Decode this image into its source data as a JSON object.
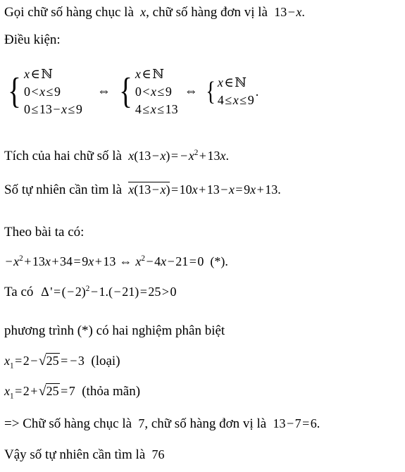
{
  "document": {
    "language": "vi",
    "background_color": "#ffffff",
    "text_color": "#000000"
  },
  "lines": {
    "l1": {
      "prose_a": "Gọi chữ số hàng chục là",
      "var_x": "x",
      "prose_b": ", chữ số hàng đơn vị là",
      "expr_13": "13",
      "minus": "−",
      "var_x2": "x",
      "period": "."
    },
    "l2": {
      "text": "Điều kiện:"
    },
    "systems": {
      "sys1": {
        "rows": [
          {
            "lhs": "x",
            "rel": "∈",
            "rhs": "ℕ"
          },
          {
            "a": "0",
            "rel1": "<",
            "v": "x",
            "rel2": "≤",
            "b": "9"
          },
          {
            "a": "0",
            "rel1": "≤",
            "mid_num": "13",
            "mid_op": "−",
            "mid_var": "x",
            "rel2": "≤",
            "b": "9"
          }
        ]
      },
      "equiv_1": "⇔",
      "sys2": {
        "rows": [
          {
            "lhs": "x",
            "rel": "∈",
            "rhs": "ℕ"
          },
          {
            "a": "0",
            "rel1": "<",
            "v": "x",
            "rel2": "≤",
            "b": "9"
          },
          {
            "a": "4",
            "rel1": "≤",
            "v": "x",
            "rel2": "≤",
            "b": "13"
          }
        ]
      },
      "equiv_2": "⇔",
      "sys3": {
        "rows": [
          {
            "lhs": "x",
            "rel": "∈",
            "rhs": "ℕ"
          },
          {
            "a": "4",
            "rel1": "≤",
            "v": "x",
            "rel2": "≤",
            "b": "9"
          }
        ],
        "trailing": "."
      }
    },
    "l4": {
      "prose": "Tích của hai chữ số là",
      "m_x": "x",
      "m_lparen": "(",
      "m_13": "13",
      "m_minus": "−",
      "m_x2": "x",
      "m_rparen": ")",
      "m_eq": "=",
      "m_neg": "−",
      "m_x3": "x",
      "m_sup": "2",
      "m_plus": "+",
      "m_13x_num": "13",
      "m_13x_var": "x",
      "period": "."
    },
    "l5": {
      "prose": "Số tự nhiên cần tìm là",
      "ov_x": "x",
      "ov_lparen": "(",
      "ov_13": "13",
      "ov_minus": "−",
      "ov_x2": "x",
      "ov_rparen": ")",
      "eq1": "=",
      "t1_num": "10",
      "t1_var": "x",
      "plus1": "+",
      "t2": "13",
      "minus1": "−",
      "t3": "x",
      "eq2": "=",
      "t4_num": "9",
      "t4_var": "x",
      "plus2": "+",
      "t5": "13",
      "period": "."
    },
    "l6": {
      "text": "Theo bài ta có:"
    },
    "l7": {
      "neg": "−",
      "x": "x",
      "sup": "2",
      "plus1": "+",
      "c13_num": "13",
      "c13_var": "x",
      "plus2": "+",
      "c34": "34",
      "eq1": "=",
      "r9_num": "9",
      "r9_var": "x",
      "plus3": "+",
      "r13": "13",
      "equiv": "⇔",
      "x2": "x",
      "sup2": "2",
      "minus1": "−",
      "c4_num": "4",
      "c4_var": "x",
      "minus2": "−",
      "c21": "21",
      "eq2": "=",
      "zero": "0",
      "star": "(*)",
      "period": "."
    },
    "l8": {
      "prose": "Ta có",
      "delta": "Δ",
      "prime": "'",
      "eq": "=",
      "lp": "(",
      "neg2": "−",
      "two": "2",
      "rp": ")",
      "sup": "2",
      "minus": "−",
      "one": "1",
      "dot": ".",
      "lp2": "(",
      "neg21": "−",
      "twentyone": "21",
      "rp2": ")",
      "eq2": "=",
      "twentyfive": "25",
      "gt": ">",
      "zero": "0"
    },
    "l9": {
      "text": "phương trình (*) có hai nghiệm phân biệt"
    },
    "l10": {
      "x": "x",
      "sub": "1",
      "eq": "=",
      "two": "2",
      "minus": "−",
      "radical": "√",
      "radicand": "25",
      "eq2": "=",
      "neg3": "−",
      "three": "3",
      "note": "(loại)"
    },
    "l11": {
      "x": "x",
      "sub": "1",
      "eq": "=",
      "two": "2",
      "plus": "+",
      "radical": "√",
      "radicand": "25",
      "eq2": "=",
      "seven": "7",
      "note": "(thỏa mãn)"
    },
    "l12": {
      "arrow": "=>",
      "prose_a": "Chữ số hàng chục là",
      "seven": "7",
      "prose_b": ", chữ số hàng đơn vị là",
      "m13": "13",
      "minus": "−",
      "m7": "7",
      "eq": "=",
      "m6": "6",
      "period": "."
    },
    "l13": {
      "prose": "Vậy số tự nhiên cần tìm là",
      "answer": "76"
    }
  }
}
